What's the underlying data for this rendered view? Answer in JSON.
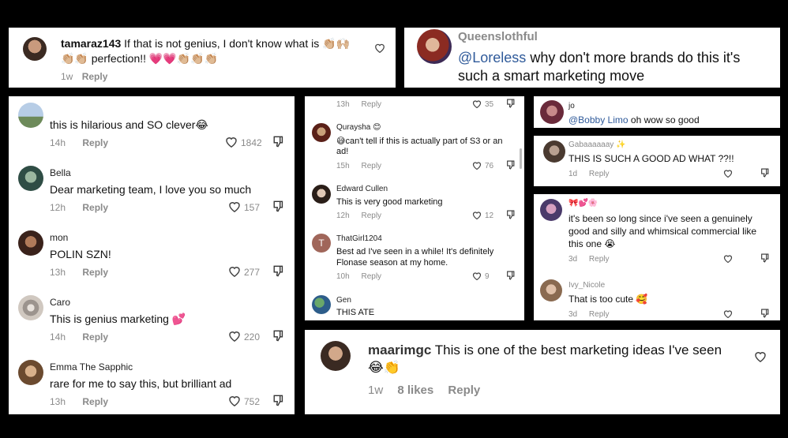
{
  "p1": {
    "username": "tamaraz143",
    "text_line1": "If that is not genius, I don't know what is",
    "text_line2": "perfection!!",
    "emoji_line1": "👏🏼🙌🏼",
    "emoji_line2_pre": "👏🏼👏🏼",
    "emoji_line2_post": "💗💗👏🏼👏🏼👏🏼",
    "time": "1w",
    "reply": "Reply"
  },
  "p2": {
    "username": "Queenslothful",
    "mention": "@Loreless",
    "text_line1": "why don't more brands do this it's",
    "text_line2": "such a smart marketing move"
  },
  "p3": {
    "comments": [
      {
        "name": "",
        "text": "this is hilarious and SO clever",
        "emoji": "😂",
        "time": "14h",
        "reply": "Reply",
        "likes": "1842"
      },
      {
        "name": "Bella",
        "text": "Dear marketing team, I love you so much",
        "emoji": "",
        "time": "12h",
        "reply": "Reply",
        "likes": "157"
      },
      {
        "name": "mon",
        "text": "POLIN SZN!",
        "emoji": "",
        "time": "13h",
        "reply": "Reply",
        "likes": "277"
      },
      {
        "name": "Caro",
        "text": "This is genius marketing",
        "emoji": "💕",
        "time": "14h",
        "reply": "Reply",
        "likes": "220"
      },
      {
        "name": "Emma The Sapphic",
        "text": "rare for me to say this, but brilliant ad",
        "emoji": "",
        "time": "13h",
        "reply": "Reply",
        "likes": "752"
      }
    ]
  },
  "p4": {
    "top": {
      "time": "13h",
      "reply": "Reply",
      "likes": "35"
    },
    "comments": [
      {
        "name": "Quraysha",
        "name_emoji": "😊",
        "line1_emoji": "😅",
        "line1": "can't tell if this is actually part of S3 or an",
        "line2": "ad!",
        "time": "15h",
        "reply": "Reply",
        "likes": "76"
      },
      {
        "name": "Edward Cullen",
        "line1": "This is very good marketing",
        "line2": "",
        "time": "12h",
        "reply": "Reply",
        "likes": "12"
      },
      {
        "name": "ThatGirl1204",
        "line1": "Best ad I've seen in a while! It's definitely",
        "line2": "Flonase season at my home.",
        "time": "10h",
        "reply": "Reply",
        "likes": "9"
      },
      {
        "name": "Gen",
        "line1": "THIS ATE",
        "line2": ""
      }
    ]
  },
  "p5": {
    "name": "jo",
    "mention": "@Bobby  Limo",
    "text": "oh wow so good"
  },
  "p6": {
    "name": "Gabaaaaaay",
    "name_emoji": "✨",
    "text": "THIS IS SUCH A GOOD AD WHAT ??!!",
    "time": "1d",
    "reply": "Reply"
  },
  "p7": {
    "name_emoji": "🎀💕🌸",
    "line1": "it's been so long since i've seen a genuinely",
    "line2": "good and silly and whimsical commercial like",
    "line3": "this one",
    "line3_emoji": "😭",
    "time": "3d",
    "reply": "Reply",
    "name2": "Ivy_Nicole",
    "text2": "That is too cute",
    "text2_emoji": "🥰",
    "time2": "3d",
    "reply2": "Reply"
  },
  "p8": {
    "username": "maarimgc",
    "text": "This is one of the best marketing ideas I've seen",
    "emoji": "😂👏",
    "time": "1w",
    "likes": "8 likes",
    "reply": "Reply"
  },
  "colors": {
    "background": "#000000",
    "panel": "#ffffff",
    "meta_gray": "#8a8a8a",
    "mention_blue": "#2f5a9a",
    "heart_pink": "#ff2d87"
  }
}
